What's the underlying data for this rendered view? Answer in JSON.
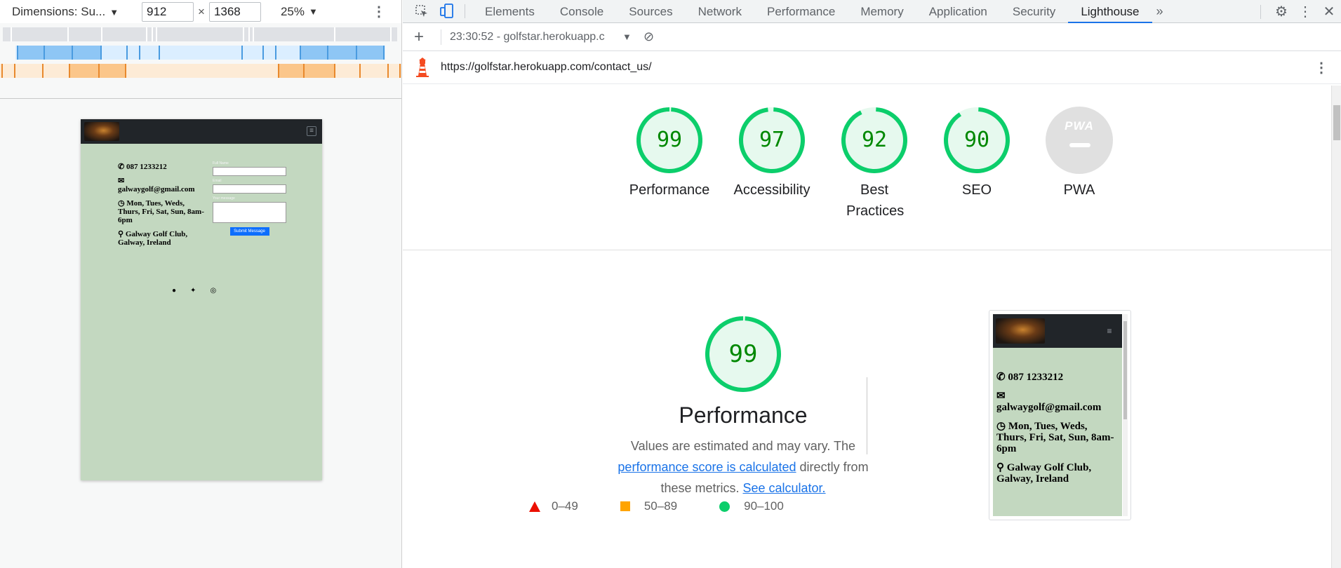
{
  "device_toolbar": {
    "dimensions_label": "Dimensions: Su...",
    "width_value": "912",
    "times": "×",
    "height_value": "1368",
    "zoom": "25%"
  },
  "device_page": {
    "phone": "087 1233212",
    "email": "galwaygolf@gmail.com",
    "hours": "Mon, Tues, Weds, Thurs, Fri, Sat, Sun, 8am-6pm",
    "location": "Galway Golf Club, Galway, Ireland",
    "form": {
      "name_label": "Full Name",
      "email_label": "Email",
      "message_label": "Your message",
      "submit_label": "Submit Message"
    }
  },
  "devtools_tabs": [
    "Elements",
    "Console",
    "Sources",
    "Network",
    "Performance",
    "Memory",
    "Application",
    "Security",
    "Lighthouse"
  ],
  "active_tab": "Lighthouse",
  "lighthouse": {
    "report_label": "23:30:52 - golfstar.herokuapp.c",
    "url": "https://golfstar.herokuapp.com/contact_us/",
    "scores": [
      {
        "label": "Performance",
        "score": 99
      },
      {
        "label": "Accessibility",
        "score": 97
      },
      {
        "label": "Best Practices",
        "score": 92
      },
      {
        "label": "SEO",
        "score": 90
      }
    ],
    "pwa": {
      "label": "PWA",
      "badge": "PWA"
    },
    "performance": {
      "score": "99",
      "title": "Performance",
      "desc_prefix": "Values are estimated and may vary. The ",
      "link_score": "performance score is calculated",
      "desc_middle": " directly from these metrics. ",
      "link_calc": "See calculator."
    },
    "legend": {
      "fail": "0–49",
      "average": "50–89",
      "pass": "90–100"
    },
    "colors": {
      "pass": "#0cce6b",
      "pass_text": "#008800",
      "pass_bg": "#e6f9ee",
      "average": "#ffa400",
      "fail": "#eb0f00"
    }
  }
}
